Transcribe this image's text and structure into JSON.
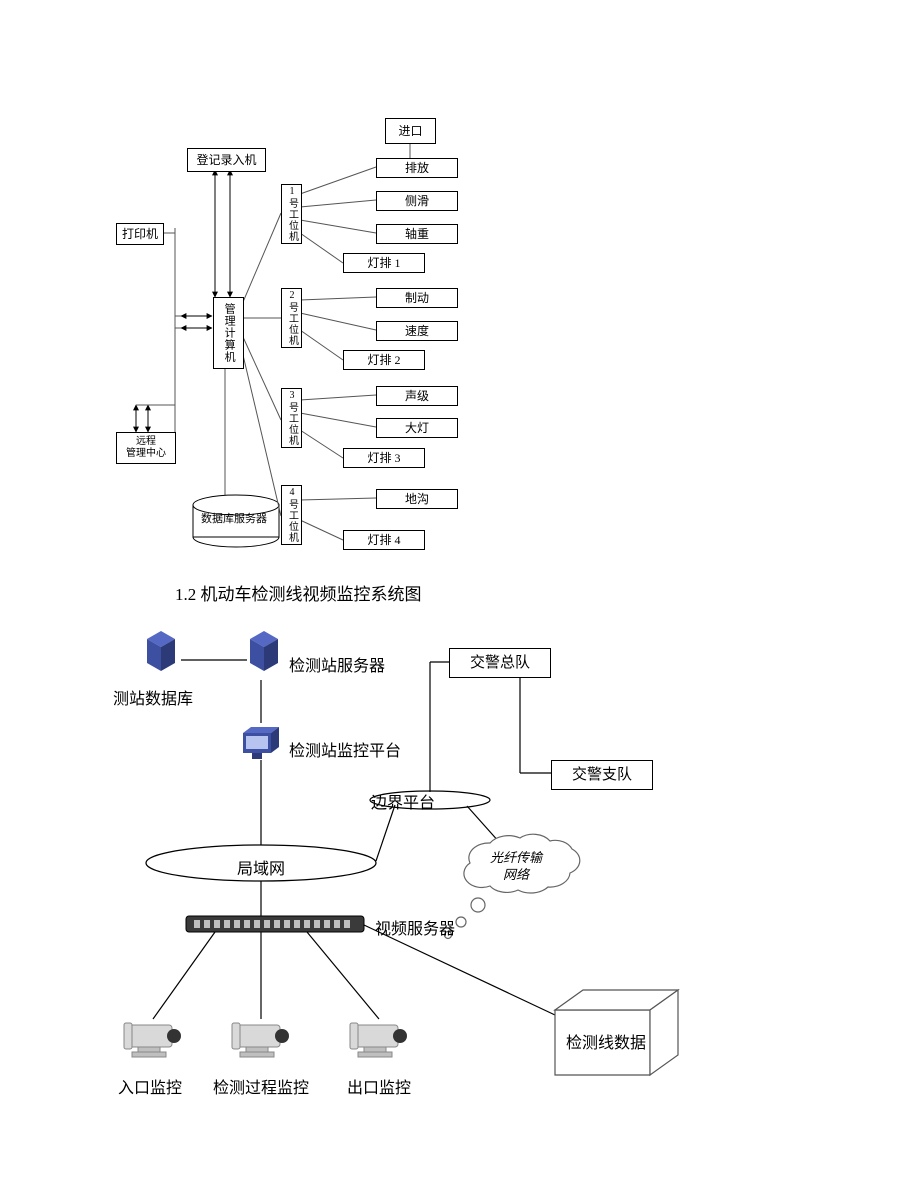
{
  "diagram1": {
    "left": {
      "registrator": "登记录入机",
      "printer": "打印机",
      "remote_center": "远程\n管理中心",
      "manager": "管理计算机",
      "db_server": "数据库服务器"
    },
    "import": "进口",
    "station1": {
      "label": "1号工位机",
      "items": [
        "排放",
        "侧滑",
        "轴重"
      ],
      "light": "灯排 1"
    },
    "station2": {
      "label": "2号工位机",
      "items": [
        "制动",
        "速度"
      ],
      "light": "灯排 2"
    },
    "station3": {
      "label": "3号工位机",
      "items": [
        "声级",
        "大灯"
      ],
      "light": "灯排 3"
    },
    "station4": {
      "label": "4号工位机",
      "items": [
        "地沟"
      ],
      "light": "灯排 4"
    }
  },
  "caption": "1.2 机动车检测线视频监控系统图",
  "diagram2": {
    "db": "测站数据库",
    "server": "检测站服务器",
    "monitor_platform": "检测站监控平台",
    "police_hq": "交警总队",
    "police_branch": "交警支队",
    "boundary_platform": "边界平台",
    "lan": "局域网",
    "fiber_network": "光纤传输\n网络",
    "video_server": "视频服务器",
    "line_data": "检测线数据",
    "cam_entry": "入口监控",
    "cam_process": "检测过程监控",
    "cam_exit": "出口监控"
  }
}
